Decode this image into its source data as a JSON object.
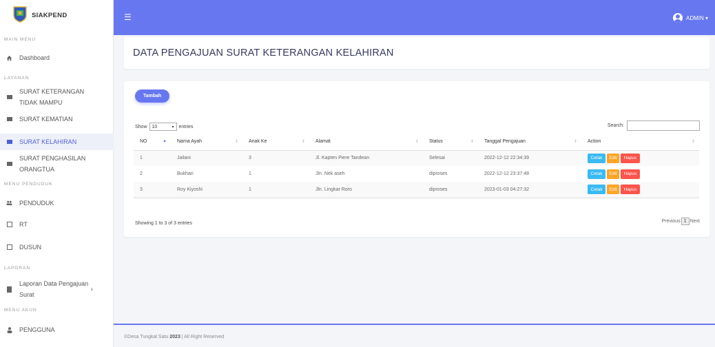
{
  "brand": {
    "name": "SIAKPEND"
  },
  "sidebar": {
    "sections": [
      "MAIN MENU",
      "LAYANAN",
      "MENU PENDUDUK",
      "LAPORAN",
      "MENU AKUN"
    ],
    "items": [
      {
        "label": "Dashboard",
        "icon": "home-icon"
      },
      {
        "label_l1": "SURAT KETERANGAN",
        "label_l2": "TIDAK MAMPU",
        "icon": "envelope-icon"
      },
      {
        "label": "SURAT KEMATIAN",
        "icon": "envelope-icon"
      },
      {
        "label": "SURAT KELAHIRAN",
        "icon": "envelope-icon",
        "active": true
      },
      {
        "label_l1": "SURAT PENGHASILAN",
        "label_l2": "ORANGTUA",
        "icon": "envelope-icon"
      },
      {
        "label": "PENDUDUK",
        "icon": "users-icon"
      },
      {
        "label": "RT",
        "icon": "square-icon"
      },
      {
        "label": "DUSUN",
        "icon": "square-icon"
      },
      {
        "label_l1": "Laporan Data Pengajuan",
        "label_l2": "Surat",
        "icon": "book-icon"
      },
      {
        "label": "PENGGUNA",
        "icon": "user-icon"
      }
    ]
  },
  "topbar": {
    "user_label": "ADMIN ▾"
  },
  "page": {
    "title": "DATA PENGAJUAN SURAT KETERANGAN KELAHIRAN"
  },
  "toolbar": {
    "add_label": "Tambah"
  },
  "table_controls": {
    "show_prefix": "Show",
    "entries_value": "10",
    "show_suffix": "entries",
    "search_label": "Search:"
  },
  "table": {
    "columns": [
      "NO",
      "Nama Ayah",
      "Anak Ke",
      "Alamat",
      "Status",
      "Tanggal Pengajuan",
      "Action"
    ],
    "rows": [
      {
        "no": "1",
        "nama_ayah": "Jailani",
        "anak_ke": "3",
        "alamat": "Jl. Kapten Piere Tandean",
        "status": "Selesai",
        "tanggal": "2022-12-12 22:34:39"
      },
      {
        "no": "2",
        "nama_ayah": "Bukhari",
        "anak_ke": "1",
        "alamat": "Jln. Nek aseh",
        "status": "diproses",
        "tanggal": "2022-12-12 23:37:48"
      },
      {
        "no": "3",
        "nama_ayah": "Roy Kiyoshi",
        "anak_ke": "1",
        "alamat": "Jln. Lingkar Roro",
        "status": "diproses",
        "tanggal": "2023-01-03 04:27:32"
      }
    ],
    "actions": {
      "print": "Cetak",
      "edit": "Edit",
      "delete": "Hapus"
    }
  },
  "pagination": {
    "info": "Showing 1 to 3 of 3 entries",
    "previous": "Previous",
    "current": "1",
    "next": "Next"
  },
  "footer": {
    "prefix": "©Desa Tungkal Satu ",
    "year": "2023",
    "suffix": " | All Right Reserved"
  },
  "colors": {
    "primary": "#6777ef",
    "info": "#3abaf4",
    "warning": "#ffa426",
    "danger": "#fc544b"
  }
}
